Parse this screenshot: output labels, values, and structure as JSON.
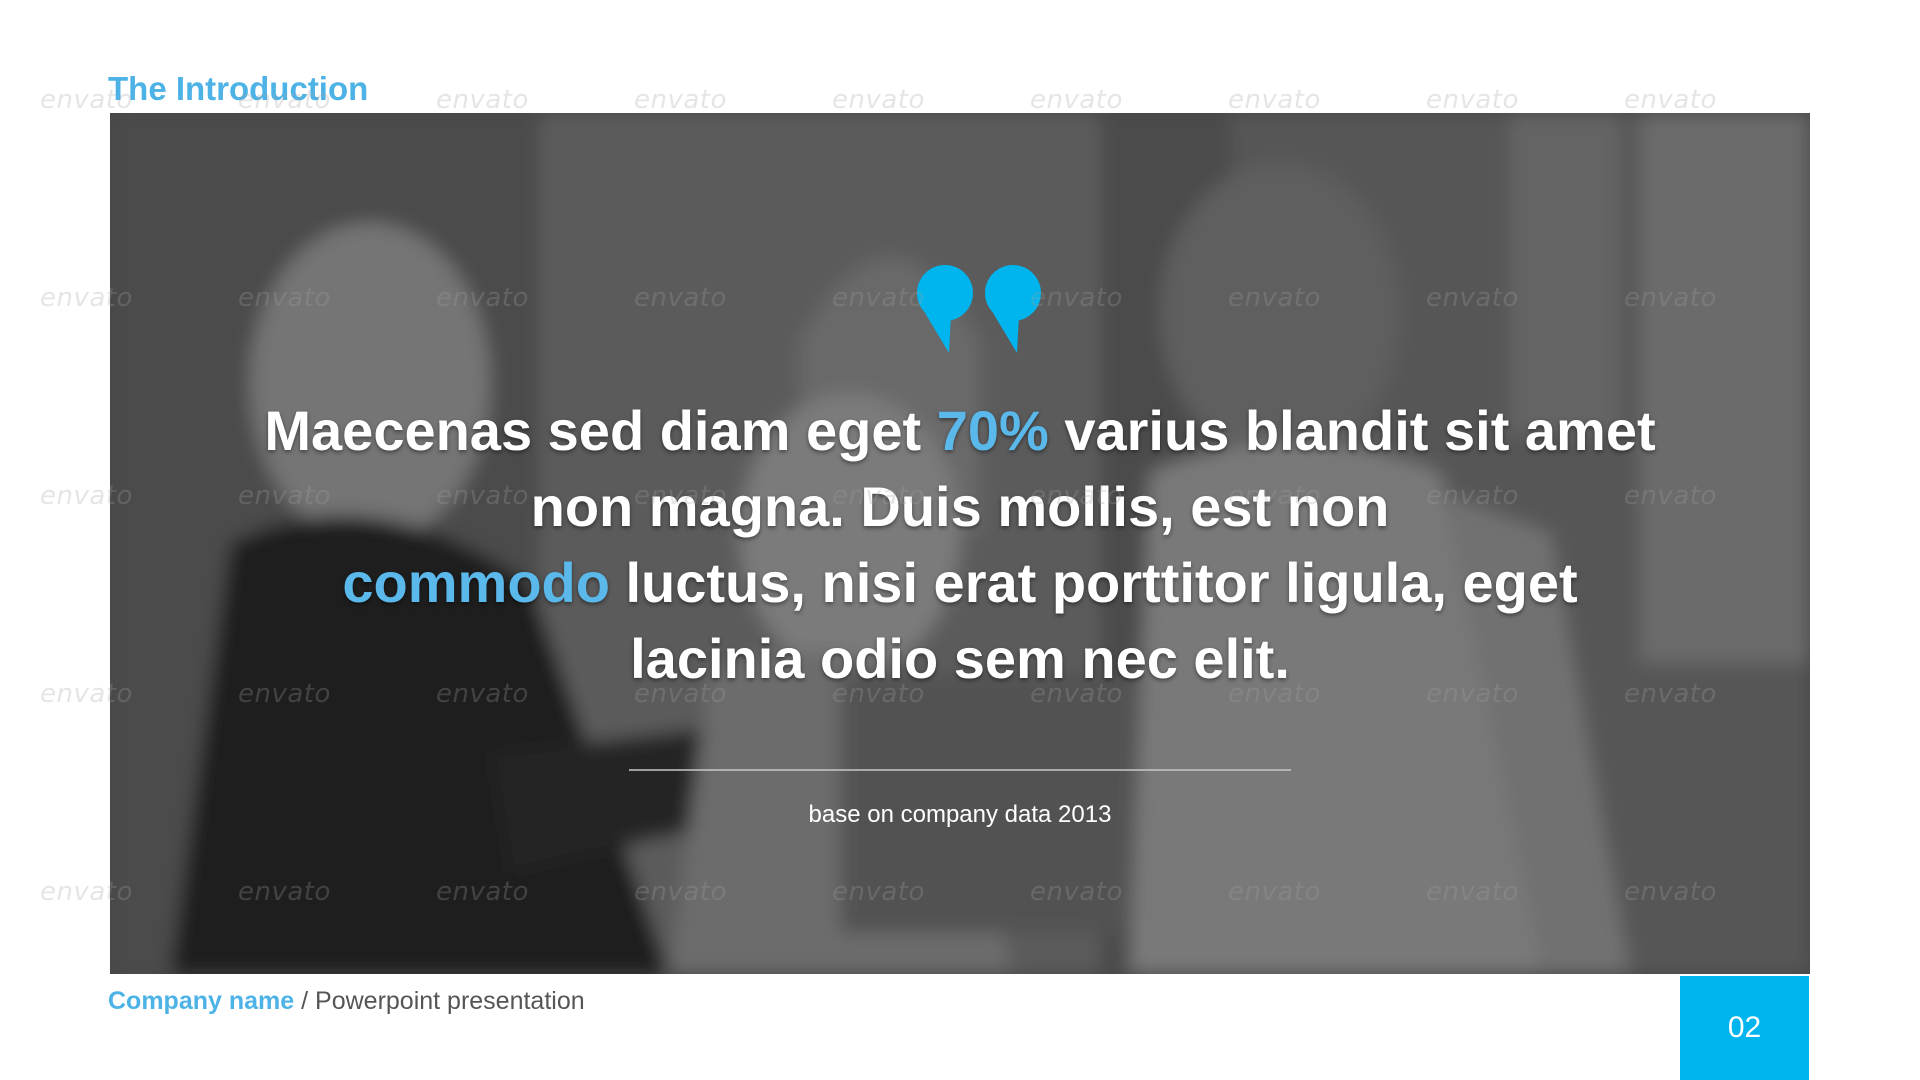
{
  "slide": {
    "title": "The Introduction",
    "quote": {
      "part1": "Maecenas sed diam eget",
      "highlight1": "70%",
      "part2": "varius blandit sit amet non magna. Duis mollis, est non",
      "highlight2": "commodo",
      "part3": "luctus, nisi erat porttitor ligula, eget lacinia odio sem nec elit."
    },
    "source": "base on company data 2013",
    "footer": {
      "company": "Company name",
      "separator": "/",
      "subtitle": "Powerpoint presentation"
    },
    "page_number": "02"
  },
  "watermark": "envato",
  "colors": {
    "accent": "#4db3e6",
    "page_box": "#00b4ee",
    "highlight": "#5ab8ea"
  },
  "icons": {
    "quote": "quote-icon"
  }
}
